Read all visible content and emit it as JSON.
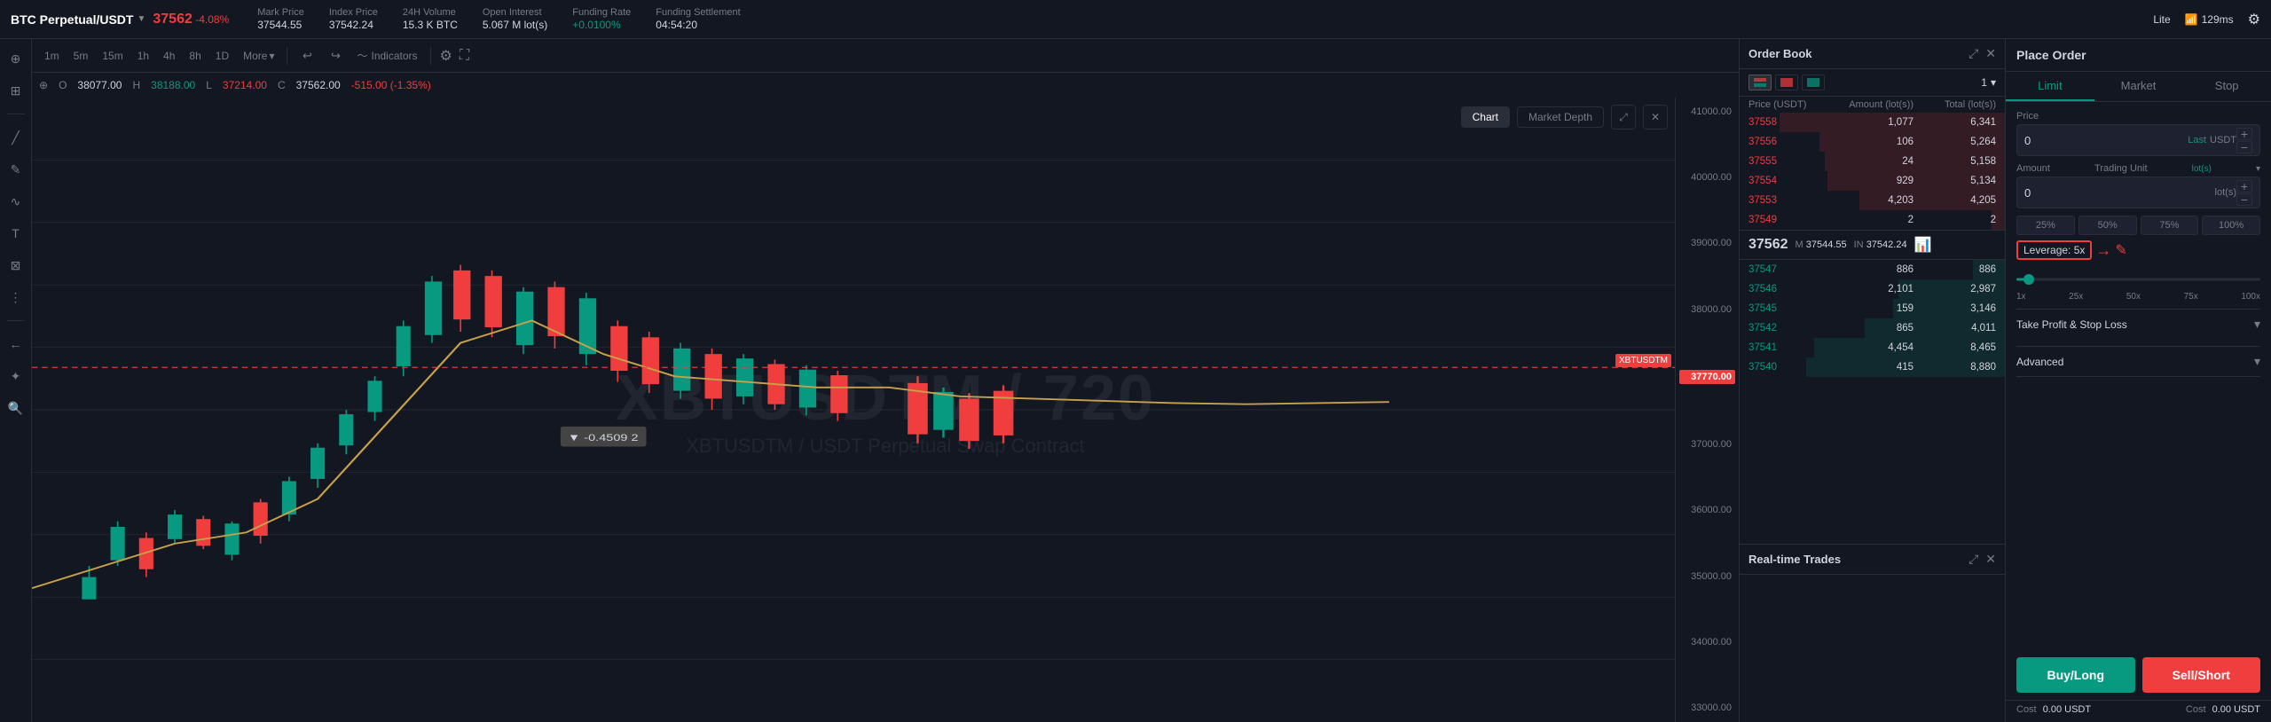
{
  "topbar": {
    "symbol": "BTC Perpetual/USDT",
    "dropdown_arrow": "▼",
    "mark_price_label": "Mark Price",
    "mark_price_value": "37544.55",
    "index_price_label": "Index Price",
    "index_price_value": "37542.24",
    "volume_label": "24H Volume",
    "volume_value": "15.3 K BTC",
    "open_interest_label": "Open Interest",
    "open_interest_value": "5.067 M lot(s)",
    "funding_rate_label": "Funding Rate",
    "funding_rate_value": "+0.0100%",
    "funding_settlement_label": "Funding Settlement",
    "funding_settlement_value": "04:54:20",
    "current_price": "37562",
    "price_change": "-4.08%",
    "lite_btn": "Lite",
    "ping": "129ms",
    "gear": "⚙"
  },
  "chart_toolbar": {
    "time_frames": [
      "1m",
      "5m",
      "15m",
      "1h",
      "4h",
      "8h",
      "1D"
    ],
    "more_label": "More",
    "indicators_label": "Indicators",
    "chart_label": "Chart",
    "market_depth_label": "Market Depth"
  },
  "ohlc": {
    "prefix": "O",
    "open": "38077.00",
    "high_prefix": "H",
    "high": "38188.00",
    "low_prefix": "L",
    "low": "37214.00",
    "close_prefix": "C",
    "close": "37562.00",
    "change": "-515.00 (-1.35%)"
  },
  "price_axis": {
    "labels": [
      "41000.00",
      "40000.00",
      "39000.00",
      "38000.00",
      "37000.00",
      "36000.00",
      "35000.00",
      "34000.00",
      "33000.00"
    ],
    "current_price": "37770.00"
  },
  "order_book": {
    "title": "Order Book",
    "col_price": "Price (USDT)",
    "col_amount": "Amount (lot(s))",
    "col_total": "Total (lot(s))",
    "asks": [
      {
        "price": "37558",
        "amount": "1,077",
        "total": "6,341",
        "bar_pct": 85
      },
      {
        "price": "37556",
        "amount": "106",
        "total": "5,264",
        "bar_pct": 70
      },
      {
        "price": "37555",
        "amount": "24",
        "total": "5,158",
        "bar_pct": 68
      },
      {
        "price": "37554",
        "amount": "929",
        "total": "5,134",
        "bar_pct": 67
      },
      {
        "price": "37553",
        "amount": "4,203",
        "total": "4,205",
        "bar_pct": 55
      },
      {
        "price": "37549",
        "amount": "2",
        "total": "2",
        "bar_pct": 5
      }
    ],
    "mid_price": "37562",
    "mark_label": "M",
    "mark_value": "37544.55",
    "index_label": "IN",
    "index_value": "37542.24",
    "bids": [
      {
        "price": "37547",
        "amount": "886",
        "total": "886",
        "bar_pct": 12
      },
      {
        "price": "37546",
        "amount": "2,101",
        "total": "2,987",
        "bar_pct": 40
      },
      {
        "price": "37545",
        "amount": "159",
        "total": "3,146",
        "bar_pct": 42
      },
      {
        "price": "37542",
        "amount": "865",
        "total": "4,011",
        "bar_pct": 53
      },
      {
        "price": "37541",
        "amount": "4,454",
        "total": "8,465",
        "bar_pct": 72
      },
      {
        "price": "37540",
        "amount": "415",
        "total": "8,880",
        "bar_pct": 75
      }
    ]
  },
  "realtime_trades": {
    "title": "Real-time Trades"
  },
  "place_order": {
    "title": "Place Order",
    "tab_limit": "Limit",
    "tab_market": "Market",
    "tab_stop": "Stop",
    "price_label": "Price",
    "price_value": "0",
    "last_label": "Last",
    "usdt_label": "USDT",
    "amount_label": "Amount",
    "trading_unit_label": "Trading Unit",
    "lots_label": "lot(s)",
    "lots_unit": "lot(s)",
    "amount_value": "0",
    "pct_25": "25%",
    "pct_50": "50%",
    "pct_75": "75%",
    "pct_100": "100%",
    "leverage_label": "Leverage: 5x",
    "slider_markers": [
      "1x",
      "25x",
      "50x",
      "75x",
      "100x"
    ],
    "take_profit_label": "Take Profit & Stop Loss",
    "advanced_label": "Advanced",
    "buy_label": "Buy/Long",
    "sell_label": "Sell/Short",
    "cost_label": "Cost",
    "cost_value": "0.00 USDT",
    "cost_label2": "Cost",
    "cost_value2": "0.00 USDT"
  },
  "xbt_label": "XBTUSDTM",
  "watermark": {
    "line1": "XBTUSDTM / 720",
    "line2": "XBTUSDTM / USDT Perpetual Swap Contract"
  }
}
